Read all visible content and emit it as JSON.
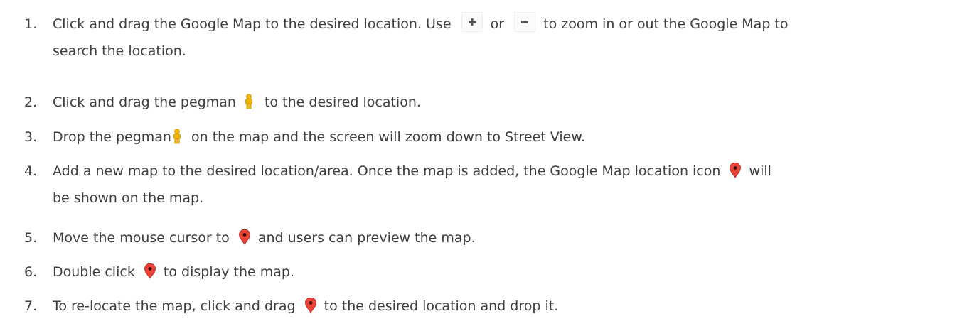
{
  "steps": [
    {
      "number": "1.",
      "line1_a": "Click and drag the Google Map to the desired location. Use",
      "line1_or": "or",
      "line1_b": "to zoom in or out the Google Map to",
      "line2": "search the location."
    },
    {
      "number": "2.",
      "text_a": "Click and drag the pegman",
      "text_b": "to the desired location."
    },
    {
      "number": "3.",
      "text_a": "Drop the pegman",
      "text_b": "on the map and the screen will zoom down to Street View."
    },
    {
      "number": "4.",
      "line1_a": "Add a new map to the desired location/area. Once the map is added, the Google Map location icon",
      "line1_b": "will",
      "line2": "be shown on the map."
    },
    {
      "number": "5.",
      "text_a": "Move the mouse cursor to",
      "text_b": "and users can preview the map."
    },
    {
      "number": "6.",
      "text_a": "Double click",
      "text_b": "to display the map."
    },
    {
      "number": "7.",
      "text_a": "To re-locate the map, click and drag",
      "text_b": "to the desired location and drop it."
    }
  ],
  "icons": {
    "zoom_in": "zoom-in-icon",
    "zoom_out": "zoom-out-icon",
    "pegman": "pegman-icon",
    "map_pin": "map-pin-icon"
  },
  "colors": {
    "text": "#3d3d3d",
    "pin_red": "#ea4335",
    "pegman_yellow": "#f4b400"
  }
}
